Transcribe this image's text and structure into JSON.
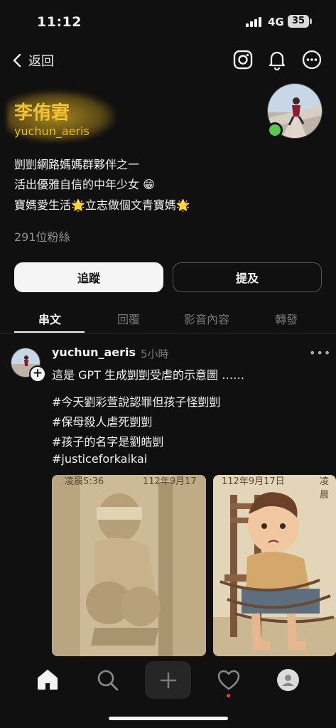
{
  "status_bar": {
    "time": "11:12",
    "network": "4G",
    "battery": "35"
  },
  "nav": {
    "back_label": "返回",
    "icons": [
      "instagram-icon",
      "bell-icon",
      "more-icon"
    ]
  },
  "profile": {
    "name": "李侑宭",
    "handle": "yuchun_aeris",
    "bio": [
      "剴剴網路媽媽群夥伴之一",
      "活出優雅自信的中年少女 😁",
      "寶媽愛生活🌟立志做個文青寶媽🌟"
    ],
    "followers": "291位粉絲",
    "online_color": "#5ac950",
    "name_color": "#f2c230"
  },
  "actions": {
    "follow": "追蹤",
    "mention": "提及"
  },
  "tabs": [
    {
      "label": "串文",
      "active": true
    },
    {
      "label": "回覆",
      "active": false
    },
    {
      "label": "影音內容",
      "active": false
    },
    {
      "label": "轉發",
      "active": false
    }
  ],
  "post": {
    "username": "yuchun_aeris",
    "time": "5小時",
    "text": "這是 GPT 生成剴剴受虐的示意圖 ……",
    "hashtags": [
      "#今天劉彩萱說認罪但孩子怪剴剴",
      "#保母殺人虐死剴剴",
      "#孩子的名字是劉皓剴",
      "#justiceforkaikai"
    ],
    "images": [
      {
        "caption_left": "凌晨5:36",
        "caption_right": "112年9月17"
      },
      {
        "caption_left": "112年9月17日",
        "caption_right": "凌晨"
      }
    ]
  },
  "bottom_nav": [
    "home-icon",
    "search-icon",
    "plus-icon",
    "heart-icon",
    "profile-icon"
  ]
}
